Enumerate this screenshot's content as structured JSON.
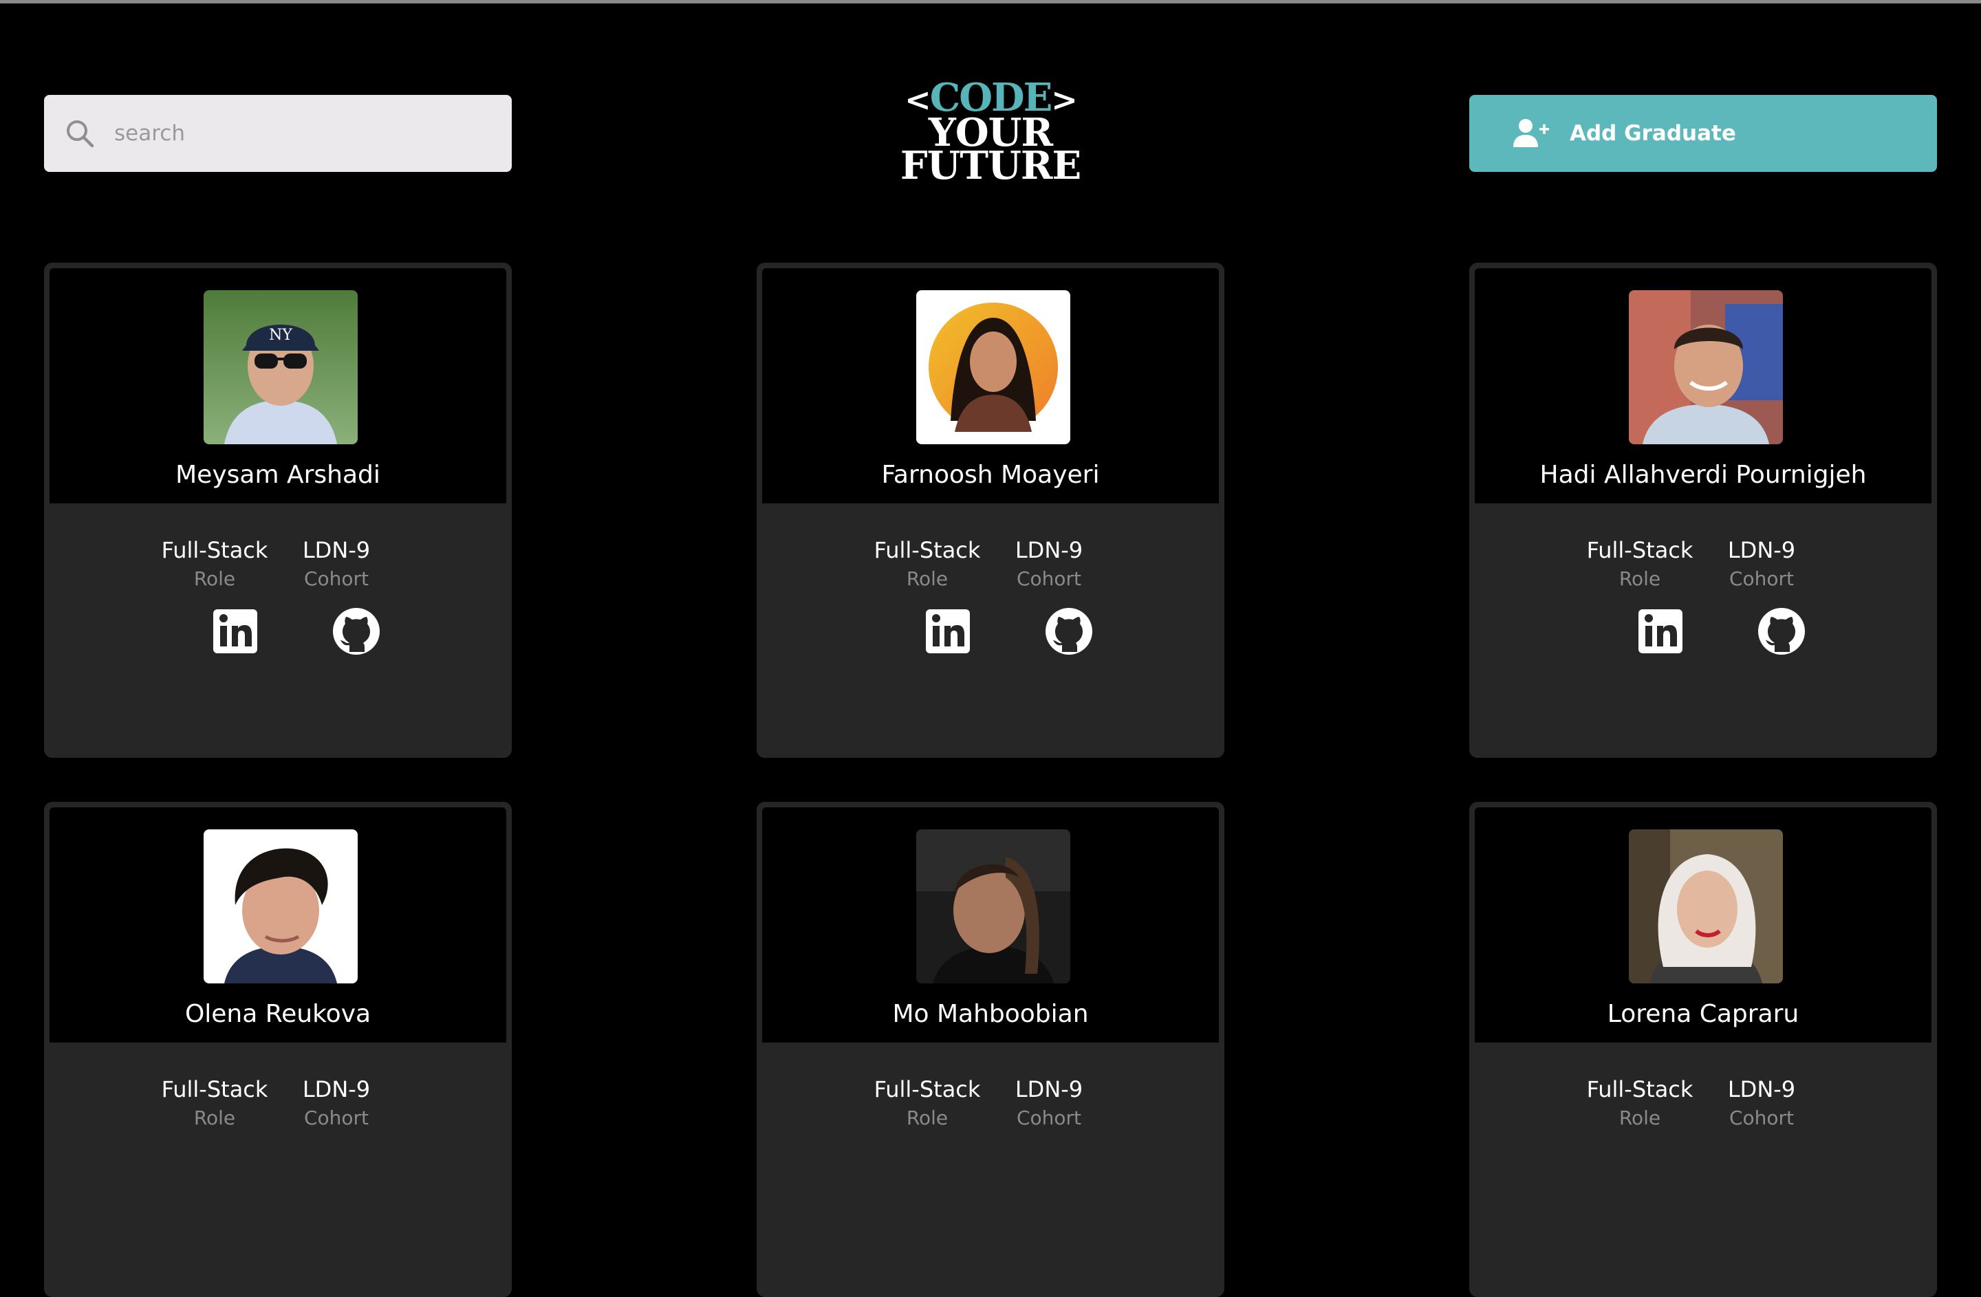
{
  "search": {
    "placeholder": "search",
    "value": ""
  },
  "logo": {
    "line1": "CODE",
    "line1_left": "<",
    "line1_right": ">",
    "line2": "YOUR",
    "line3": "FUTURE"
  },
  "add_button": {
    "label": "Add Graduate",
    "icon": "add-user-icon"
  },
  "colors": {
    "accent": "#5cb8bb",
    "background": "#000000",
    "card": "#262626",
    "muted_text": "#8a8a8a"
  },
  "graduates": [
    {
      "name": "Meysam Arshadi",
      "role": "Full-Stack",
      "role_label": "Role",
      "cohort": "LDN-9",
      "cohort_label": "Cohort"
    },
    {
      "name": "Farnoosh Moayeri",
      "role": "Full-Stack",
      "role_label": "Role",
      "cohort": "LDN-9",
      "cohort_label": "Cohort"
    },
    {
      "name": "Hadi Allahverdi Pournigjeh",
      "role": "Full-Stack",
      "role_label": "Role",
      "cohort": "LDN-9",
      "cohort_label": "Cohort"
    },
    {
      "name": "Olena Reukova",
      "role": "Full-Stack",
      "role_label": "Role",
      "cohort": "LDN-9",
      "cohort_label": "Cohort"
    },
    {
      "name": "Mo Mahboobian",
      "role": "Full-Stack",
      "role_label": "Role",
      "cohort": "LDN-9",
      "cohort_label": "Cohort"
    },
    {
      "name": "Lorena Capraru",
      "role": "Full-Stack",
      "role_label": "Role",
      "cohort": "LDN-9",
      "cohort_label": "Cohort"
    }
  ]
}
